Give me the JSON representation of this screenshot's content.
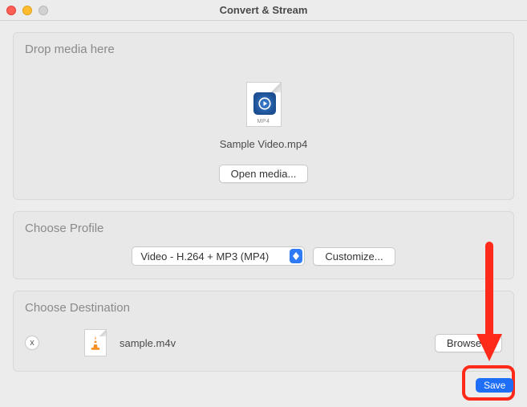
{
  "window": {
    "title": "Convert & Stream"
  },
  "drop": {
    "heading": "Drop media here",
    "file_name": "Sample Video.mp4",
    "file_type_label": "MP4",
    "open_button": "Open media..."
  },
  "profile": {
    "heading": "Choose Profile",
    "selected": "Video - H.264 + MP3 (MP4)",
    "customize_button": "Customize..."
  },
  "destination": {
    "heading": "Choose Destination",
    "file_name": "sample.m4v",
    "browse_button": "Browse...",
    "clear_symbol": "x"
  },
  "footer": {
    "save_button": "Save"
  }
}
